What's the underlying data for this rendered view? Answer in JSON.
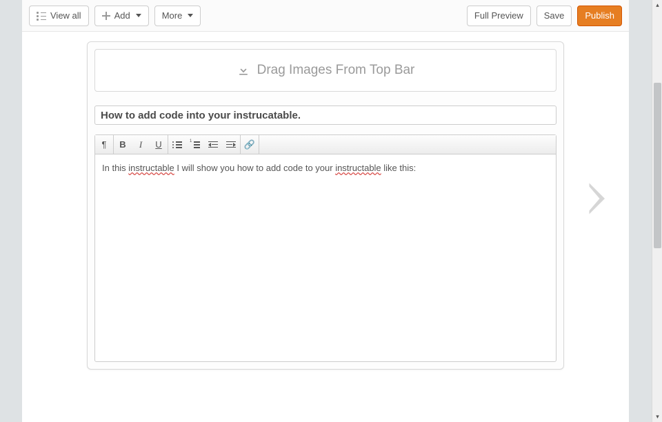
{
  "toolbar": {
    "view_all": "View all",
    "add": "Add",
    "more": "More",
    "full_preview": "Full Preview",
    "save": "Save",
    "publish": "Publish"
  },
  "dropzone": {
    "label": "Drag Images From Top Bar"
  },
  "editor": {
    "title_value": "How to add code into your instrucatable.",
    "pilcrow": "¶",
    "bold": "B",
    "italic": "I",
    "underline": "U",
    "link_glyph": "🔗",
    "body_pre": "In this ",
    "body_err1": "instructable",
    "body_mid": " I will show you how to add code to your ",
    "body_err2": "instructable",
    "body_post": " like this:"
  },
  "scroll": {
    "up": "▴",
    "down": "▾"
  }
}
